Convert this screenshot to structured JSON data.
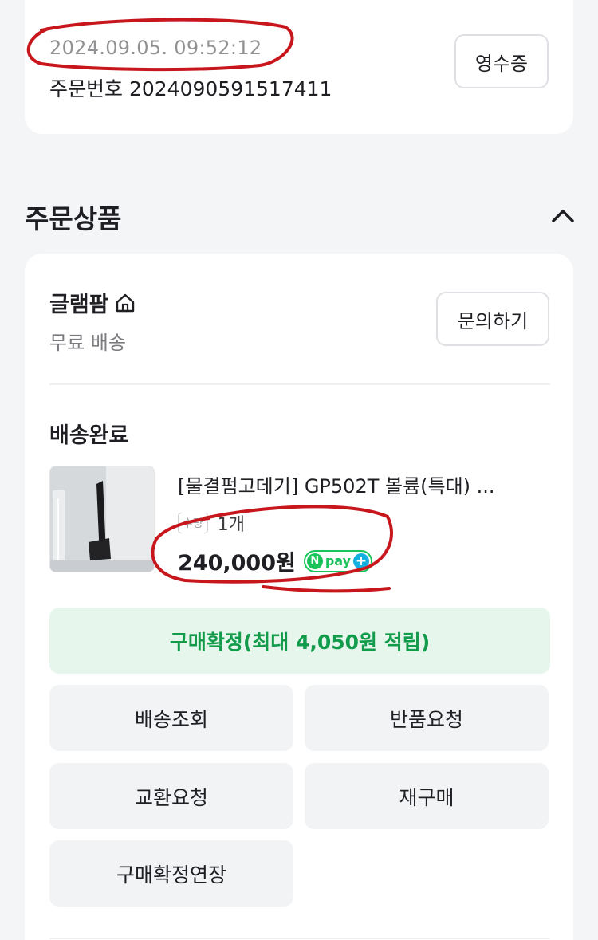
{
  "order": {
    "date": "2024.09.05. 09:52:12",
    "number": "주문번호 2024090591517411",
    "receipt_label": "영수증"
  },
  "section": {
    "title": "주문상품"
  },
  "store": {
    "name": "글램팜",
    "shipping": "무료 배송",
    "inquiry_label": "문의하기"
  },
  "item": {
    "status": "배송완료",
    "name": "[물결펌고데기] GP502T 볼륨(특대) ...",
    "qty_label": "수량",
    "qty_value": "1개",
    "price": "240,000원",
    "npay_n": "N",
    "npay_text": "pay",
    "npay_plus": "+"
  },
  "actions": {
    "confirm": "구매확정(최대 4,050원 적립)",
    "track": "배송조회",
    "return": "반품요청",
    "exchange": "교환요청",
    "rebuy": "재구매",
    "extend": "구매확정연장"
  },
  "colors": {
    "accent_green": "#129b4b",
    "npay_green": "#19c45a",
    "annotation_red": "#c8161d"
  }
}
